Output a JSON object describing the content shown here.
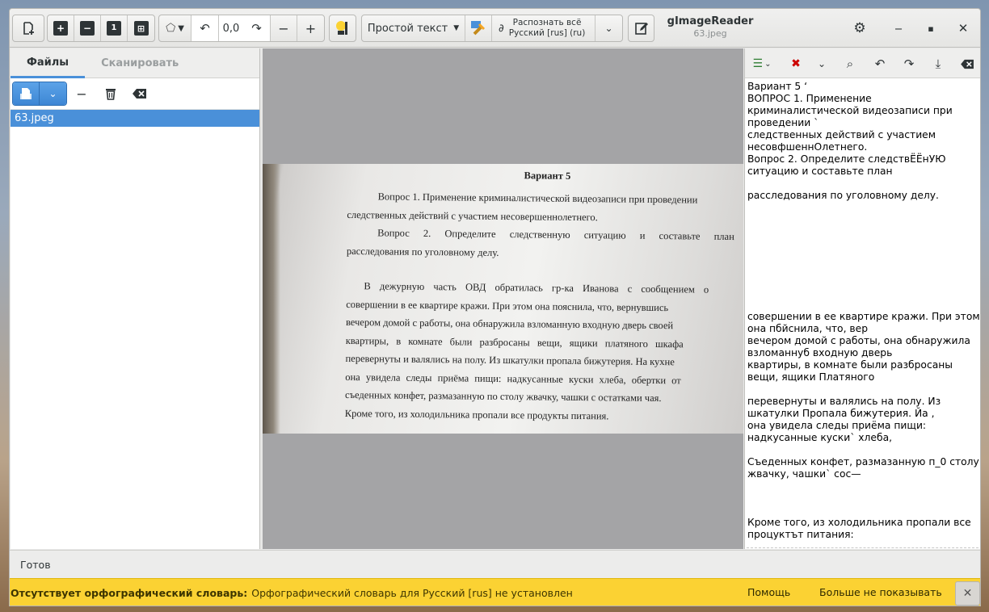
{
  "app": {
    "title": "gImageReader",
    "subtitle": "63.jpeg"
  },
  "toolbar": {
    "rotation_value": "0,0",
    "output_mode": "Простой текст",
    "recognize_line1": "Распознать всё",
    "recognize_line2": "Русский [rus] (ru)"
  },
  "sources": {
    "tabs": [
      "Файлы",
      "Сканировать"
    ],
    "active_tab": "Файлы",
    "files": [
      "63.jpeg"
    ]
  },
  "document": {
    "title": "Вариант 5",
    "lines": [
      "Вопрос 1. Применение криминалистической видеозаписи при проведении",
      "следственных действий с участием несовершеннолетнего.",
      "Вопрос 2. Определите следственную ситуацию и составьте план",
      "расследования по уголовному делу.",
      "",
      "В дежурную часть ОВД обратилась гр-ка Иванова с сообщением о",
      "совершении в ее квартире кражи. При этом она пояснила, что, вернувшись",
      "вечером домой с работы, она обнаружила взломанную входную дверь своей",
      "квартиры, в комнате были разбросаны вещи, ящики платяного шкафа",
      "перевернуты и валялись на полу. Из шкатулки пропала бижутерия. На кухне",
      "она увидела следы приёма пищи: надкусанные куски хлеба, обертки от",
      "съеденных конфет, размазанную по столу жвачку, чашки с остатками чая.",
      "Кроме того, из холодильника пропали все продукты питания."
    ]
  },
  "ocr_output": {
    "lines": [
      "Вариант 5 ‘",
      "ВОПРОС 1. Применение",
      "криминалистической видеозаписи при",
      "проведении `",
      "следственных действий с участием",
      "несовфшеннОлетнего.",
      "Вопрос 2. Определите следствЁЁнУЮ",
      "ситуацию и составьте план",
      "",
      "расследования по уголовному делу.",
      "",
      "",
      "",
      "",
      "",
      "",
      "",
      "",
      "",
      "совершении в ее квартире кражи. При этом",
      "она пбйснила, что, вер",
      "вечером домой с работы, она обнаружила",
      "взломаннуб входную дверь",
      "квартиры, в комнате были разбросаны",
      "вещи, ящики Платяного",
      "",
      "перевернуты и валялись на полу. Из",
      "шкатулки Пропала бижутерия. Йа ,",
      "она увидела следы приёма пищи:",
      "надкусанные куски` хлеба,",
      "",
      "Съеденных конфет, размазанную п_0 столу",
      "жвачку, чашки` сос—",
      "",
      "",
      "",
      "Кроме того, из холодильника пропали все",
      "процуктът питания:"
    ]
  },
  "status": {
    "text": "Готов"
  },
  "infobar": {
    "title": "Отсутствует орфографический словарь:",
    "message": "Орфографический словарь для Русский [rus] не установлен",
    "help_label": "Помощь",
    "dismiss_label": "Больше не показывать"
  },
  "colors": {
    "accent": "#4a90d9",
    "infobar": "#fbd233"
  },
  "icons": {
    "add_image": "add-image-icon",
    "zoom_in": "zoom-in-icon",
    "zoom_out": "zoom-out-icon",
    "original_size": "zoom-original-icon",
    "best_fit": "zoom-fit-icon",
    "rotate_mode": "rotate-mode-icon",
    "rotate_left": "rotate-left-icon",
    "rotate_right": "rotate-right-icon",
    "settings": "gear-icon"
  }
}
